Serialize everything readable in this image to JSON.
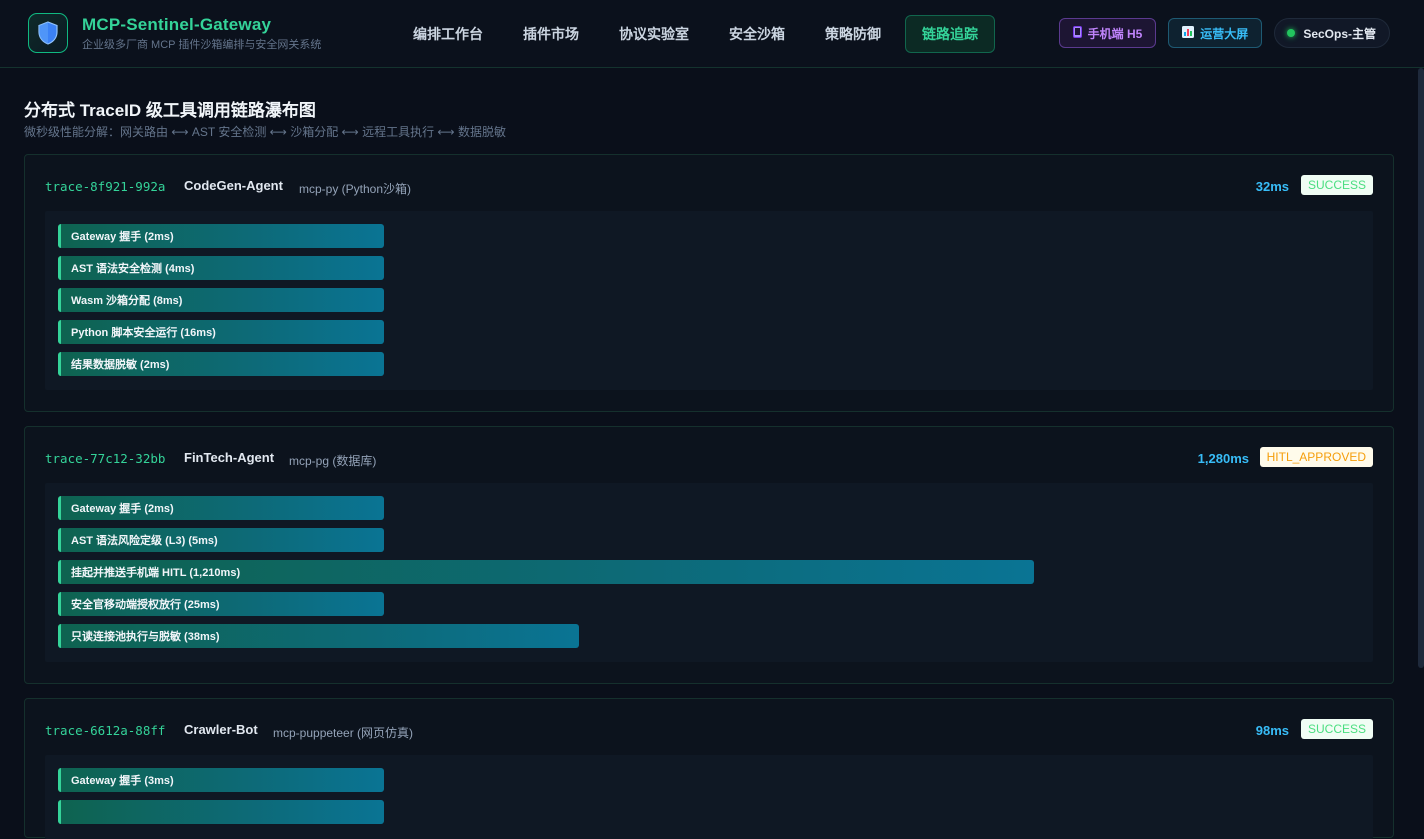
{
  "brand": {
    "title": "MCP-Sentinel-Gateway",
    "subtitle": "企业级多厂商 MCP 插件沙箱编排与安全网关系统"
  },
  "nav": {
    "items": [
      "编排工作台",
      "插件市场",
      "协议实验室",
      "安全沙箱",
      "策略防御"
    ],
    "active": "链路追踪"
  },
  "header_actions": {
    "mobile_label": "手机端 H5",
    "dashboard_label": "运营大屏",
    "user_label": "SecOps-主管"
  },
  "page": {
    "title": "分布式 TraceID 级工具调用链路瀑布图",
    "subtitle": "微秒级性能分解：网关路由 ⟷ AST 安全检测 ⟷ 沙箱分配 ⟷ 远程工具执行 ⟷ 数据脱敏"
  },
  "traces": [
    {
      "trace_id": "trace-8f921-992a",
      "agent": "CodeGen-Agent",
      "service": "mcp-py (Python沙箱)",
      "duration": "32ms",
      "status": "SUCCESS",
      "spans": [
        {
          "label": "Gateway 握手 (2ms)"
        },
        {
          "label": "AST 语法安全检测 (4ms)"
        },
        {
          "label": "Wasm 沙箱分配 (8ms)"
        },
        {
          "label": "Python 脚本安全运行 (16ms)"
        },
        {
          "label": "结果数据脱敏 (2ms)"
        }
      ]
    },
    {
      "trace_id": "trace-77c12-32bb",
      "agent": "FinTech-Agent",
      "service": "mcp-pg (数据库)",
      "duration": "1,280ms",
      "status": "HITL_APPROVED",
      "spans": [
        {
          "label": "Gateway 握手 (2ms)"
        },
        {
          "label": "AST 语法风险定级 (L3) (5ms)"
        },
        {
          "label": "挂起并推送手机端 HITL (1,210ms)"
        },
        {
          "label": "安全官移动端授权放行 (25ms)"
        },
        {
          "label": "只读连接池执行与脱敏 (38ms)"
        }
      ]
    },
    {
      "trace_id": "trace-6612a-88ff",
      "agent": "Crawler-Bot",
      "service": "mcp-puppeteer (网页仿真)",
      "duration": "98ms",
      "status": "SUCCESS",
      "spans": [
        {
          "label": "Gateway 握手 (3ms)"
        },
        {
          "label": ""
        }
      ]
    }
  ]
}
